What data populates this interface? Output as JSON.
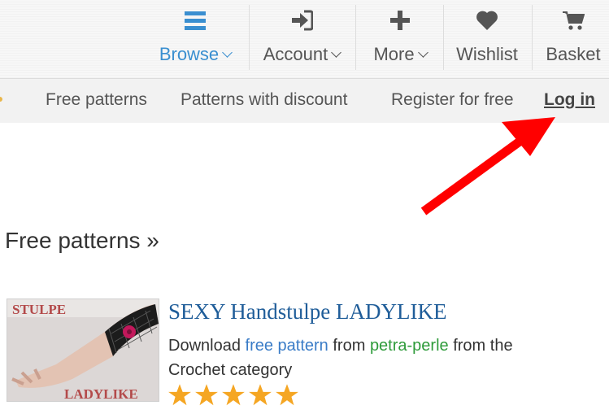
{
  "nav": {
    "items": [
      {
        "label": "Browse",
        "icon": "menu-icon",
        "active": true,
        "has_dropdown": true
      },
      {
        "label": "Account",
        "icon": "sign-in-icon",
        "active": false,
        "has_dropdown": true
      },
      {
        "label": "More",
        "icon": "plus-icon",
        "active": false,
        "has_dropdown": true
      },
      {
        "label": "Wishlist",
        "icon": "heart-icon",
        "active": false,
        "has_dropdown": false
      },
      {
        "label": "Basket",
        "icon": "cart-icon",
        "active": false,
        "has_dropdown": false
      }
    ],
    "accent_color": "#3a8fd0"
  },
  "subnav": {
    "free_patterns": "Free patterns",
    "patterns_with_discount": "Patterns with discount",
    "register": "Register for free",
    "login": "Log in"
  },
  "annotation": {
    "color": "#ff0000",
    "points_to": "Log in"
  },
  "main": {
    "section_title": "Free patterns »",
    "card": {
      "image_text_top": "STULPE",
      "image_text_bottom": "LADYLIKE",
      "title": "SEXY Handstulpe LADYLIKE",
      "desc_prefix": "Download ",
      "desc_link1": "free pattern",
      "desc_mid": " from ",
      "desc_author": "petra-perle",
      "desc_suffix": " from the Crochet category",
      "rating": 5,
      "rating_max": 5,
      "star_color": "#f5a623"
    }
  }
}
